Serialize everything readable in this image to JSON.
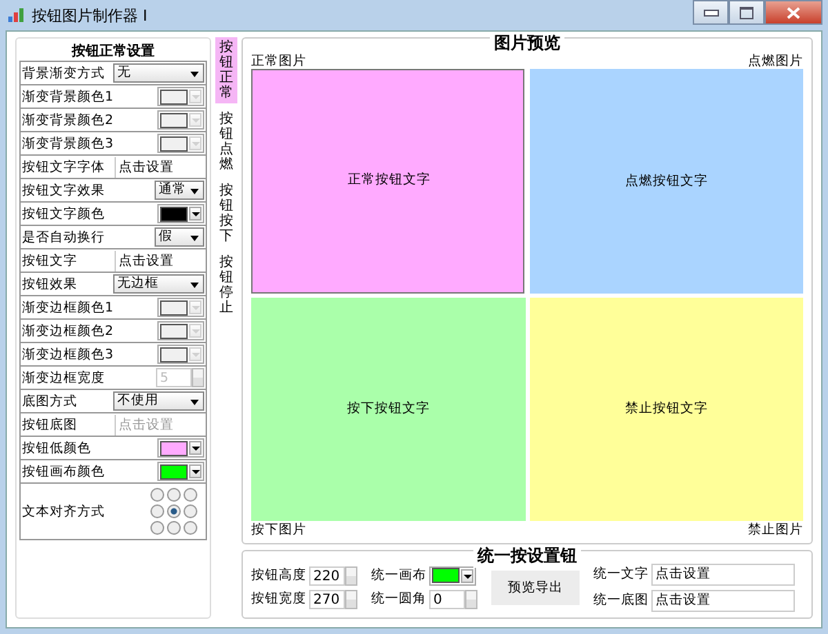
{
  "window": {
    "title": "按钮图片制作器 I"
  },
  "settings": {
    "title": "按钮正常设置",
    "rows": [
      {
        "label": "背景渐变方式",
        "kind": "select",
        "value": "无"
      },
      {
        "label": "渐变背景颜色1",
        "kind": "color",
        "color": "#f0f0f0",
        "disabled": true
      },
      {
        "label": "渐变背景颜色2",
        "kind": "color",
        "color": "#f0f0f0",
        "disabled": true
      },
      {
        "label": "渐变背景颜色3",
        "kind": "color",
        "color": "#f0f0f0",
        "disabled": true
      },
      {
        "label": "按钮文字字体",
        "kind": "text",
        "value": "点击设置",
        "disabled": false
      },
      {
        "label": "按钮文字效果",
        "kind": "short-select",
        "value": "通常"
      },
      {
        "label": "按钮文字颜色",
        "kind": "color",
        "color": "#000000",
        "disabled": false
      },
      {
        "label": "是否自动换行",
        "kind": "short-select",
        "value": "假"
      },
      {
        "label": "按钮文字",
        "kind": "text",
        "value": "点击设置",
        "disabled": false
      },
      {
        "label": "按钮效果",
        "kind": "select",
        "value": "无边框"
      },
      {
        "label": "渐变边框颜色1",
        "kind": "color",
        "color": "#f0f0f0",
        "disabled": true
      },
      {
        "label": "渐变边框颜色2",
        "kind": "color",
        "color": "#f0f0f0",
        "disabled": true
      },
      {
        "label": "渐变边框颜色3",
        "kind": "color",
        "color": "#f0f0f0",
        "disabled": true
      },
      {
        "label": "渐变边框宽度",
        "kind": "spin",
        "value": "5",
        "disabled": true
      },
      {
        "label": "底图方式",
        "kind": "select",
        "value": "不使用"
      },
      {
        "label": "按钮底图",
        "kind": "text",
        "value": "点击设置",
        "disabled": true
      },
      {
        "label": "按钮低颜色",
        "kind": "color",
        "color": "#ffaaff",
        "disabled": false
      },
      {
        "label": "按钮画布颜色",
        "kind": "color",
        "color": "#00ff00",
        "disabled": false
      },
      {
        "label": "文本对齐方式",
        "kind": "align",
        "options": [
          {
            "selected": false
          },
          {
            "selected": false
          },
          {
            "selected": false
          },
          {
            "selected": false
          },
          {
            "selected": true
          },
          {
            "selected": false
          },
          {
            "selected": false
          },
          {
            "selected": false
          },
          {
            "selected": false
          }
        ]
      }
    ]
  },
  "tabs": [
    {
      "label": "按钮正常",
      "selected": true
    },
    {
      "label": "按钮点燃",
      "selected": false
    },
    {
      "label": "按钮按下",
      "selected": false
    },
    {
      "label": "按钮停止",
      "selected": false
    }
  ],
  "preview": {
    "title": "图片预览",
    "cells": [
      {
        "caption": "正常图片",
        "text": "正常按钮文字",
        "color": "#ffaaff",
        "selected": true
      },
      {
        "caption": "点燃图片",
        "text": "点燃按钮文字",
        "color": "#aad4ff",
        "selected": false
      },
      {
        "caption": "按下图片",
        "text": "按下按钮文字",
        "color": "#aaffaa",
        "selected": false
      },
      {
        "caption": "禁止图片",
        "text": "禁止按钮文字",
        "color": "#ffff99",
        "selected": false
      }
    ]
  },
  "unified": {
    "title": "统一按设置钮",
    "height": {
      "label": "按钮高度",
      "value": "220"
    },
    "width": {
      "label": "按钮宽度",
      "value": "270"
    },
    "canvas": {
      "label": "统一画布",
      "color": "#00ff00"
    },
    "corner": {
      "label": "统一圆角",
      "value": "0"
    },
    "export_button": "预览导出",
    "text": {
      "label": "统一文字",
      "value": "点击设置"
    },
    "image": {
      "label": "统一底图",
      "value": "点击设置"
    }
  }
}
